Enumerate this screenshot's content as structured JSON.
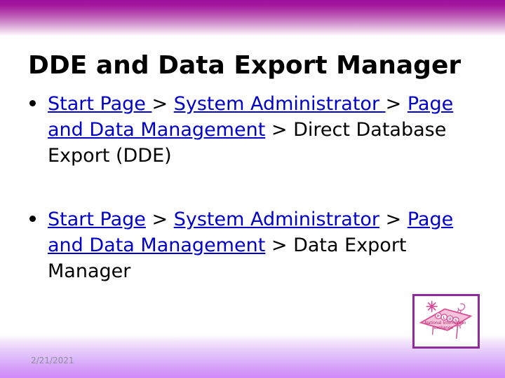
{
  "slide": {
    "title": "DDE and Data Export Manager",
    "date": "2/21/2021",
    "colors": {
      "band_top": "#9c0f9c",
      "band_bottom": "#d089f8",
      "link": "#0000c8",
      "text": "#000000",
      "date_text": "#8e8e9a",
      "logo_border": "#8e2a9a",
      "logo_pink": "#e0469a",
      "logo_light_pink": "#f6c3da"
    },
    "bullets": [
      {
        "segments": [
          {
            "text": "Start Page ",
            "type": "link"
          },
          {
            "text": "> ",
            "type": "plain"
          },
          {
            "text": "System Administrator ",
            "type": "link"
          },
          {
            "text": "> ",
            "type": "plain"
          },
          {
            "text": "Page and Data Management",
            "type": "link"
          },
          {
            "text": " > Direct Database Export (DDE)",
            "type": "plain"
          }
        ]
      },
      {
        "segments": [
          {
            "text": "Start Page",
            "type": "link"
          },
          {
            "text": " > ",
            "type": "plain"
          },
          {
            "text": "System Administrator",
            "type": "link"
          },
          {
            "text": " > ",
            "type": "plain"
          },
          {
            "text": "Page and Data Management",
            "type": "link"
          },
          {
            "text": " > Data Export Manager",
            "type": "plain"
          }
        ]
      }
    ],
    "logo": {
      "name": "plus-national-information-exchange-logo",
      "top_text": "PLUS",
      "line1": "National Information",
      "line2": "exchange"
    }
  }
}
